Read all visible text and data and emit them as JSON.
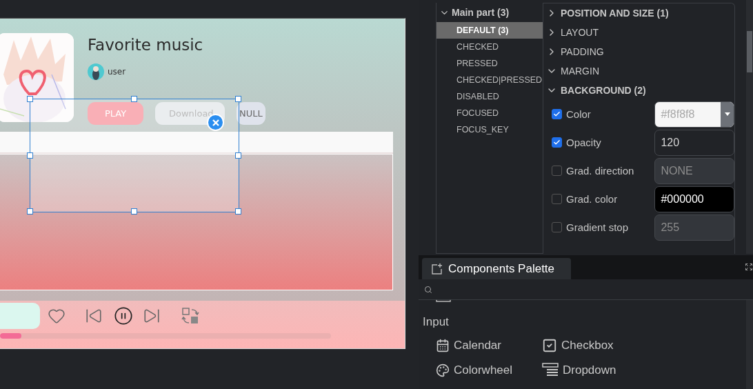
{
  "screen": {
    "title": "Favorite music",
    "user": "user",
    "buttons": [
      {
        "label": "PLAY",
        "kind": "primary"
      },
      {
        "label": "Download",
        "kind": "secondary"
      },
      {
        "label": "NULL",
        "kind": "plain"
      }
    ],
    "progress": {
      "level": 0.065
    }
  },
  "style_tree": {
    "part": "Main part (3)",
    "expanded": true,
    "states": [
      {
        "label": "DEFAULT (3)",
        "selected": true
      },
      {
        "label": "CHECKED",
        "selected": false
      },
      {
        "label": "PRESSED",
        "selected": false
      },
      {
        "label": "CHECKED|PRESSED",
        "selected": false
      },
      {
        "label": "DISABLED",
        "selected": false
      },
      {
        "label": "FOCUSED",
        "selected": false
      },
      {
        "label": "FOCUS_KEY",
        "selected": false
      }
    ]
  },
  "sections": [
    {
      "label": "POSITION AND SIZE (1)",
      "expanded": false,
      "emphasized": true
    },
    {
      "label": "LAYOUT",
      "expanded": false,
      "emphasized": false
    },
    {
      "label": "PADDING",
      "expanded": false,
      "emphasized": false
    },
    {
      "label": "MARGIN",
      "expanded": true,
      "emphasized": false
    },
    {
      "label": "BACKGROUND (2)",
      "expanded": true,
      "emphasized": true
    }
  ],
  "properties": [
    {
      "label": "Color",
      "checked": true,
      "value": "#f8f8f8",
      "kind": "color_select"
    },
    {
      "label": "Opacity",
      "checked": true,
      "value": "120",
      "kind": "text"
    },
    {
      "label": "Grad. direction",
      "checked": false,
      "value": "NONE",
      "kind": "text"
    },
    {
      "label": "Grad. color",
      "checked": false,
      "value": "#000000",
      "kind": "color_input"
    },
    {
      "label": "Gradient stop",
      "checked": false,
      "value": "255",
      "kind": "text"
    }
  ],
  "palette": {
    "title": "Components Palette",
    "group": "Input",
    "items": [
      {
        "label": "Calendar",
        "kind": "calendar"
      },
      {
        "label": "Checkbox",
        "kind": "checkbox"
      },
      {
        "label": "Colorwheel",
        "kind": "colorwheel"
      },
      {
        "label": "Dropdown",
        "kind": "dropdown"
      }
    ]
  }
}
